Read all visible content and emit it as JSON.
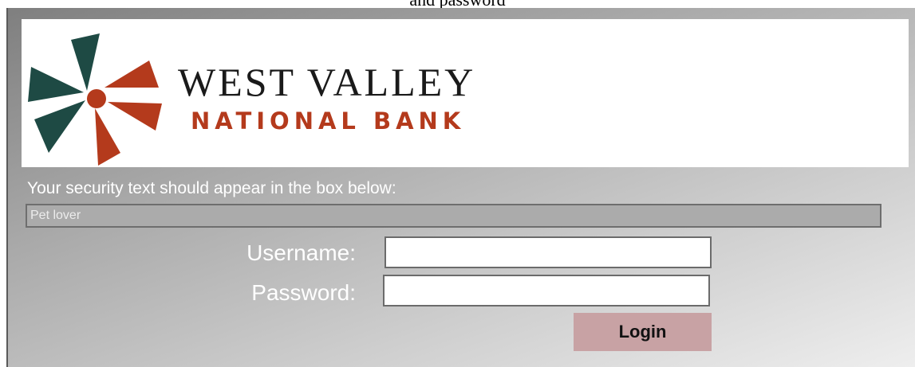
{
  "caption": {
    "text": "and password"
  },
  "logo": {
    "title": "WEST VALLEY",
    "subtitle": "NATIONAL BANK",
    "colors": {
      "dark": "#1e4a44",
      "accent": "#b43a1c"
    },
    "icon": "pinwheel-sun-icon"
  },
  "security": {
    "prompt": "Your security text should appear in the box below:",
    "phrase": "Pet lover"
  },
  "form": {
    "username_label": "Username:",
    "username_value": "",
    "password_label": "Password:",
    "password_value": "",
    "login_label": "Login"
  },
  "colors": {
    "login_button": "#c8a2a4",
    "panel_gradient_start": "#7f7f7f",
    "panel_gradient_end": "#eeeeee"
  }
}
